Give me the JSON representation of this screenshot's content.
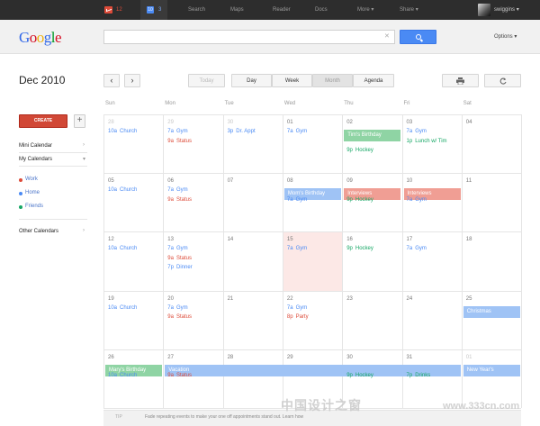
{
  "topbar": {
    "mail_count": "12",
    "cal_icon_text": "10",
    "cal_count": "3",
    "items": [
      "Search",
      "Maps",
      "Reader",
      "Docs",
      "More",
      "Share"
    ],
    "more_caret": "▾",
    "share_caret": "▾",
    "user": "swiggins",
    "user_caret": "▾"
  },
  "header": {
    "logo_letters": [
      {
        "ch": "G",
        "color": "#3369e8"
      },
      {
        "ch": "o",
        "color": "#d50f25"
      },
      {
        "ch": "o",
        "color": "#eeb211"
      },
      {
        "ch": "g",
        "color": "#3369e8"
      },
      {
        "ch": "l",
        "color": "#009925"
      },
      {
        "ch": "e",
        "color": "#d50f25"
      }
    ],
    "search_value": "",
    "search_clear": "✕",
    "options_label": "Options",
    "options_caret": "▾"
  },
  "toolbar": {
    "month_title": "Dec 2010",
    "prev": "‹",
    "next": "›",
    "today": "Today",
    "views": [
      "Day",
      "Week",
      "Month",
      "Agenda"
    ],
    "selected_view": "Month"
  },
  "sidebar": {
    "create": "CREATE",
    "plus": "+",
    "mini_calendar": "Mini Calendar",
    "my_calendars": "My Calendars",
    "arrow_right": "›",
    "arrow_down": "▾",
    "calendars": [
      {
        "name": "Work",
        "color": "#dd4b39"
      },
      {
        "name": "Home",
        "color": "#4a8af4"
      },
      {
        "name": "Friends",
        "color": "#16a765"
      }
    ],
    "other_calendars": "Other Calendars"
  },
  "colors": {
    "work": "#dd4b39",
    "home": "#4a8af4",
    "friends": "#16a765",
    "bar_green": "#8fd4a4",
    "bar_red": "#f09e94",
    "bar_blue": "#9fc3f5"
  },
  "days_of_week": [
    "Sun",
    "Mon",
    "Tue",
    "Wed",
    "Thu",
    "Fri",
    "Sat"
  ],
  "weeks": [
    [
      "28",
      "29",
      "30",
      "01",
      "02",
      "03",
      "04"
    ],
    [
      "05",
      "06",
      "07",
      "08",
      "09",
      "10",
      "11"
    ],
    [
      "12",
      "13",
      "14",
      "15",
      "16",
      "17",
      "18"
    ],
    [
      "19",
      "20",
      "21",
      "22",
      "23",
      "24",
      "25"
    ],
    [
      "26",
      "27",
      "28",
      "29",
      "30",
      "31",
      "01"
    ]
  ],
  "events": [
    {
      "week": 0,
      "day": 0,
      "slot": 0,
      "time": "10a",
      "title": "Church",
      "cal": "home"
    },
    {
      "week": 0,
      "day": 1,
      "slot": 0,
      "time": "7a",
      "title": "Gym",
      "cal": "home"
    },
    {
      "week": 0,
      "day": 1,
      "slot": 1,
      "time": "9a",
      "title": "Status",
      "cal": "work"
    },
    {
      "week": 0,
      "day": 2,
      "slot": 0,
      "time": "3p",
      "title": "Dr. Appt",
      "cal": "home"
    },
    {
      "week": 0,
      "day": 3,
      "slot": 0,
      "time": "7a",
      "title": "Gym",
      "cal": "home"
    },
    {
      "week": 0,
      "day": 4,
      "slot": 2,
      "time": "9p",
      "title": "Hockey",
      "cal": "friends"
    },
    {
      "week": 0,
      "day": 5,
      "slot": 0,
      "time": "7a",
      "title": "Gym",
      "cal": "home"
    },
    {
      "week": 0,
      "day": 5,
      "slot": 1,
      "time": "1p",
      "title": "Lunch w/ Tim",
      "cal": "friends"
    },
    {
      "week": 1,
      "day": 0,
      "slot": 0,
      "time": "10a",
      "title": "Church",
      "cal": "home"
    },
    {
      "week": 1,
      "day": 1,
      "slot": 0,
      "time": "7a",
      "title": "Gym",
      "cal": "home"
    },
    {
      "week": 1,
      "day": 1,
      "slot": 1,
      "time": "9a",
      "title": "Status",
      "cal": "work"
    },
    {
      "week": 1,
      "day": 3,
      "slot": 1,
      "time": "7a",
      "title": "Gym",
      "cal": "home"
    },
    {
      "week": 1,
      "day": 4,
      "slot": 1,
      "time": "9p",
      "title": "Hockey",
      "cal": "friends"
    },
    {
      "week": 1,
      "day": 5,
      "slot": 1,
      "time": "7a",
      "title": "Gym",
      "cal": "home"
    },
    {
      "week": 2,
      "day": 0,
      "slot": 0,
      "time": "10a",
      "title": "Church",
      "cal": "home"
    },
    {
      "week": 2,
      "day": 1,
      "slot": 0,
      "time": "7a",
      "title": "Gym",
      "cal": "home"
    },
    {
      "week": 2,
      "day": 1,
      "slot": 1,
      "time": "9a",
      "title": "Status",
      "cal": "work"
    },
    {
      "week": 2,
      "day": 1,
      "slot": 2,
      "time": "7p",
      "title": "Dinner",
      "cal": "home"
    },
    {
      "week": 2,
      "day": 3,
      "slot": 0,
      "time": "7a",
      "title": "Gym",
      "cal": "home"
    },
    {
      "week": 2,
      "day": 4,
      "slot": 0,
      "time": "9p",
      "title": "Hockey",
      "cal": "friends"
    },
    {
      "week": 2,
      "day": 5,
      "slot": 0,
      "time": "7a",
      "title": "Gym",
      "cal": "home"
    },
    {
      "week": 3,
      "day": 0,
      "slot": 0,
      "time": "10a",
      "title": "Church",
      "cal": "home"
    },
    {
      "week": 3,
      "day": 1,
      "slot": 0,
      "time": "7a",
      "title": "Gym",
      "cal": "home"
    },
    {
      "week": 3,
      "day": 1,
      "slot": 1,
      "time": "9a",
      "title": "Status",
      "cal": "work"
    },
    {
      "week": 3,
      "day": 3,
      "slot": 0,
      "time": "7a",
      "title": "Gym",
      "cal": "home"
    },
    {
      "week": 3,
      "day": 3,
      "slot": 1,
      "time": "8p",
      "title": "Party",
      "cal": "work"
    },
    {
      "week": 4,
      "day": 0,
      "slot": 1,
      "time": "10a",
      "title": "Church",
      "cal": "home"
    },
    {
      "week": 4,
      "day": 1,
      "slot": 1,
      "time": "9a",
      "title": "Status",
      "cal": "work"
    },
    {
      "week": 4,
      "day": 4,
      "slot": 1,
      "time": "9p",
      "title": "Hockey",
      "cal": "friends"
    },
    {
      "week": 4,
      "day": 5,
      "slot": 1,
      "time": "7p",
      "title": "Drinks",
      "cal": "friends"
    }
  ],
  "bars": [
    {
      "week": 0,
      "day": 4,
      "span": 1,
      "title": "Tim's Birthday",
      "color": "bar_green"
    },
    {
      "week": 1,
      "day": 3,
      "span": 1,
      "title": "Mom's Birthday",
      "color": "bar_blue"
    },
    {
      "week": 1,
      "day": 4,
      "span": 1,
      "title": "Interviews",
      "color": "bar_red"
    },
    {
      "week": 1,
      "day": 5,
      "span": 1,
      "title": "Interviews",
      "color": "bar_red"
    },
    {
      "week": 3,
      "day": 6,
      "span": 1,
      "title": "Christmas",
      "color": "bar_blue"
    },
    {
      "week": 4,
      "day": 0,
      "span": 1,
      "title": "Mary's Birthday",
      "color": "bar_green"
    },
    {
      "week": 4,
      "day": 1,
      "span": 5,
      "title": "Vacation",
      "color": "bar_blue"
    },
    {
      "week": 4,
      "day": 6,
      "span": 1,
      "title": "New Year's",
      "color": "bar_blue"
    }
  ],
  "today": {
    "week": 2,
    "day": 3
  },
  "tip": {
    "label": "TIP",
    "text": "Fade repeating events to make your one off appointments stand out. Learn how"
  },
  "watermark": {
    "text": "中国设计之窗",
    "url": "www.333cn.com"
  }
}
